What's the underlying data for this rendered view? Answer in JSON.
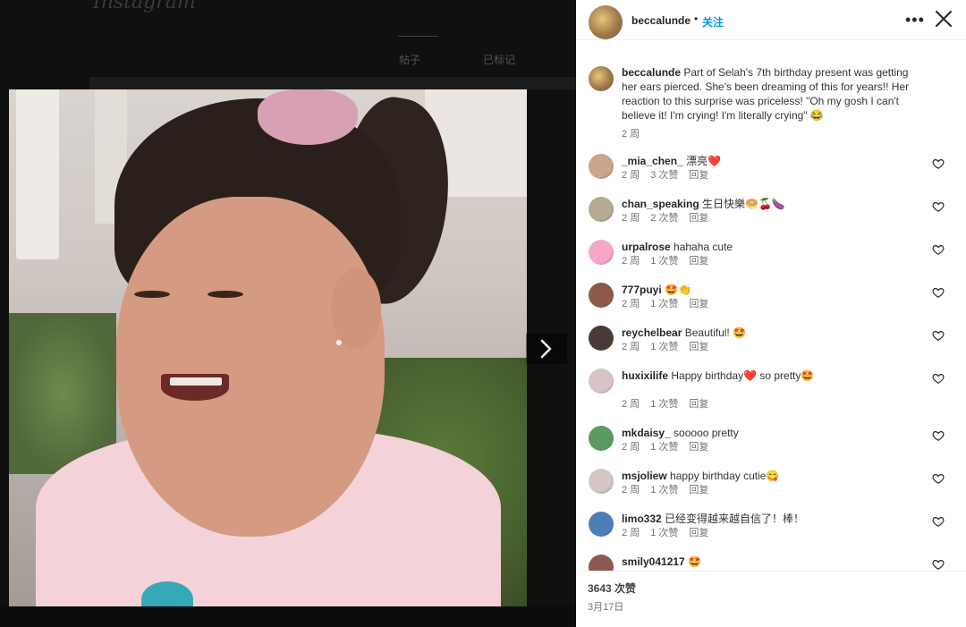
{
  "background": {
    "logo": "Instagram",
    "tab_posts": "帖子",
    "tab_tagged": "已标记"
  },
  "post": {
    "username": "beccalunde",
    "dot": "•",
    "follow_label": "关注",
    "more_icon": "more-horizontal-icon",
    "close_icon": "close-icon",
    "caption": "Part of Selah's 7th birthday present was getting her ears pierced. She's been dreaming of this for years!! Her reaction to this surprise was priceless! \"Oh my gosh I can't believe it! I'm crying! I'm literally crying\" 😂",
    "caption_time": "2 周",
    "likes": "3643 次赞",
    "date": "3月17日"
  },
  "comments": [
    {
      "user": "_mia_chen_",
      "text": "漂亮❤️",
      "time": "2 周",
      "likes": "3 次赞",
      "reply": "回复",
      "avatar_color": "#c9a58a"
    },
    {
      "user": "chan_speaking",
      "text": "生日快樂🥯🍒🍆",
      "time": "2 周",
      "likes": "2 次赞",
      "reply": "回复",
      "avatar_color": "#b7aa92"
    },
    {
      "user": "urpalrose",
      "text": "hahaha cute",
      "time": "2 周",
      "likes": "1 次赞",
      "reply": "回复",
      "avatar_color": "#f5a7c8"
    },
    {
      "user": "777puyi",
      "text": "🤩👏",
      "time": "2 周",
      "likes": "1 次赞",
      "reply": "回复",
      "avatar_color": "#8b5a48"
    },
    {
      "user": "reychelbear",
      "text": "Beautiful! 🤩",
      "time": "2 周",
      "likes": "1 次赞",
      "reply": "回复",
      "avatar_color": "#4a3a34"
    },
    {
      "user": "huxixilife",
      "text": "Happy birthday❤️ so pretty🤩",
      "time": "2 周",
      "likes": "1 次赞",
      "reply": "回复",
      "avatar_color": "#d9c3c7"
    },
    {
      "user": "mkdaisy_",
      "text": "sooooo pretty",
      "time": "2 周",
      "likes": "1 次赞",
      "reply": "回复",
      "avatar_color": "#5c9a63"
    },
    {
      "user": "msjoliew",
      "text": "happy birthday cutie😋",
      "time": "2 周",
      "likes": "1 次赞",
      "reply": "回复",
      "avatar_color": "#d4c6c2"
    },
    {
      "user": "limo332",
      "text": "已经变得越来越自信了！棒！",
      "time": "2 周",
      "likes": "1 次赞",
      "reply": "回复",
      "avatar_color": "#4b7fb5"
    },
    {
      "user": "smily041217",
      "text": "🤩",
      "time": "",
      "likes": "",
      "reply": "",
      "avatar_color": "#8a5a50"
    }
  ],
  "colors": {
    "accent": "#0095f6",
    "heart": "#262626",
    "overlay": "#141414"
  }
}
